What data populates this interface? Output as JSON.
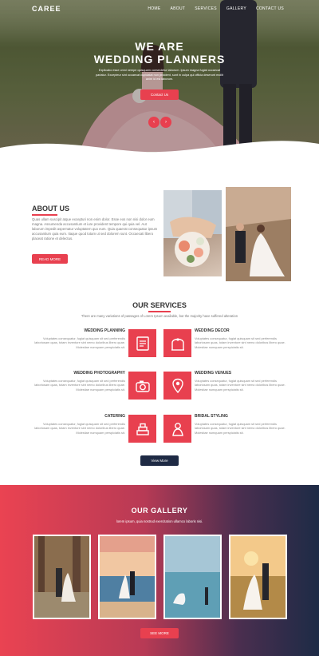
{
  "nav": {
    "logo": "CAREE",
    "items": [
      "HOME",
      "ABOUT",
      "SERVICES",
      "GALLERY",
      "CONTACT US"
    ]
  },
  "hero": {
    "title_line1": "WE ARE",
    "title_line2": "WEDDING PLANNERS",
    "subtitle": "Explicabo esse omni nempe quisquam consectetur laborum. Ipsum magna fugiat occaecat pariatur. Excepteur sint occaecat cupidatat non proident, sunt in culpa qui officia deserunt mollit anim id est laborum.",
    "button": "Contact Us",
    "prev": "‹",
    "next": "›"
  },
  "about": {
    "title": "ABOUT US",
    "text": "Quas ullam suscipit atque excepturi non enim dolor. Esse eos non nisi dolor eum magna. Assumenda accusantium et iure provident tempore qui quia vel. Aut laborum impedit aspernatur voluptatem quo eum. Quia quaerat consequatur ipsum accusantium quia eum. Itaque quod totam ut sed dolorem sunt. Occaecati libero placeat ratione et delectus.",
    "button": "READ MORE"
  },
  "services": {
    "title": "OUR SERVICES",
    "subtitle": "There are many variations of passages of Lorem Ipsum available, but the majority have suffered alteration",
    "desc": "Voluptates consequatur, fugiat quisquam sit sed perferendis laboriosam quas, totam inventore sint nemo doloribus libero quae. Molestiae numquam perspiciatis sit.",
    "items": [
      {
        "name": "WEDDING PLANNING",
        "icon": "planning-icon"
      },
      {
        "name": "WEDDING DECOR",
        "icon": "decor-arch-icon"
      },
      {
        "name": "WEDDING PHOTOGRAPHY",
        "icon": "camera-icon"
      },
      {
        "name": "WEDDING VENUES",
        "icon": "venue-pin-icon"
      },
      {
        "name": "CATERING",
        "icon": "cake-icon"
      },
      {
        "name": "BRIDAL STYLING",
        "icon": "bride-icon"
      }
    ],
    "button": "View More"
  },
  "gallery": {
    "title": "OUR GALLERY",
    "subtitle": "lorem ipsum, quia nostrud exercitation ullamco laboris nisi.",
    "button": "SEE MORE"
  },
  "colors": {
    "accent": "#e8404f",
    "navy": "#1e2a44"
  }
}
